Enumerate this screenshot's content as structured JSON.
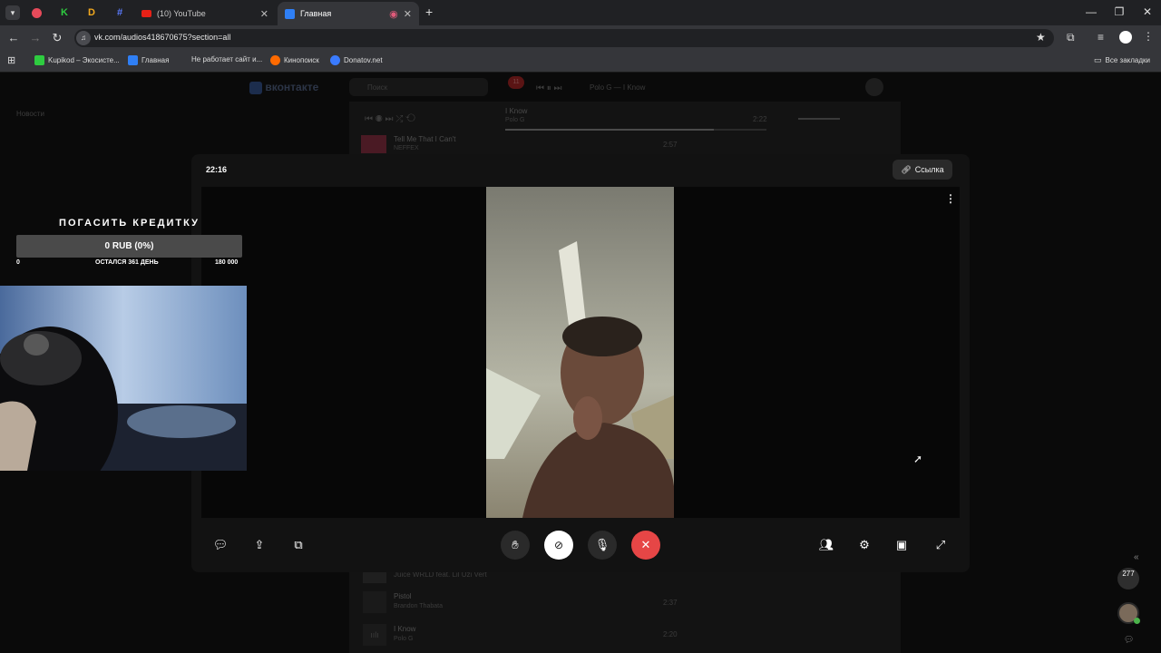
{
  "browser": {
    "tabs": [
      {
        "label": "(10) YouTube"
      },
      {
        "label": "Главная"
      }
    ],
    "url": "vk.com/audios418670675?section=all",
    "bookmarks": [
      {
        "label": "Kupikod – Экосисте..."
      },
      {
        "label": "Главная"
      },
      {
        "label": "Не работает сайт и..."
      },
      {
        "label": "Кинопоиск"
      },
      {
        "label": "Donatov.net"
      }
    ],
    "all_bookmarks": "Все закладки"
  },
  "vk_background": {
    "logo": "вконтакте",
    "search_placeholder": "Поиск",
    "notif_count": "11",
    "now_playing_header": "Polo G — I Know",
    "player_track": "I Know",
    "player_artist": "Polo G",
    "player_time": "2:22",
    "news_label": "Новости",
    "tracks": [
      {
        "title": "Tell Me That I Can't",
        "artist": "NEFFEX",
        "duration": "2:57"
      },
      {
        "title": "Juice WRLD feat. Lil Uzi Vert",
        "artist": "",
        "duration": ""
      },
      {
        "title": "Pistol",
        "artist": "Brandon Thabata",
        "duration": "2:37"
      },
      {
        "title": "I Know",
        "artist": "Polo G",
        "duration": "2:20"
      }
    ]
  },
  "call": {
    "time": "22:16",
    "link_label": "Ссылка"
  },
  "stream_overlay": {
    "goal_title": "ПОГАСИТЬ КРЕДИТКУ",
    "goal_value": "0 RUB (0%)",
    "goal_min": "0",
    "goal_remaining": "ОСТАЛСЯ 361 ДЕНЬ",
    "goal_max": "180 000"
  },
  "side_widgets": {
    "chat_count": "277"
  }
}
